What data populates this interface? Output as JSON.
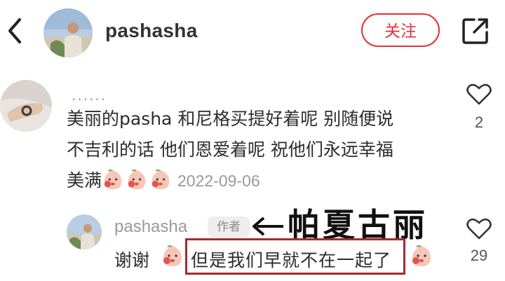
{
  "header": {
    "author_name": "pashasha",
    "follow_label": "关注",
    "icons": {
      "back": "chevron-left-icon",
      "share": "share-external-icon"
    }
  },
  "comment": {
    "commenter_name": "......",
    "text_lines": [
      "美丽的pasha 和尼格买提好着呢 别随便说",
      "不吉利的话 他们恩爱着呢  祝他们永远幸福",
      "美满"
    ],
    "emoji_name": "crying-peach-emoji",
    "emoji_count": 3,
    "date": "2022-09-06",
    "like_count": "2"
  },
  "reply": {
    "author_name": "pashasha",
    "author_tag": "作者",
    "annotation": "帕夏古丽",
    "text_start": "谢谢",
    "text_highlight": "但是我们早就不在一起了",
    "like_count": "29"
  },
  "colors": {
    "accent_red": "#e5303a",
    "highlight_box": "#a32c2c",
    "muted_text": "#9a9a9a"
  }
}
